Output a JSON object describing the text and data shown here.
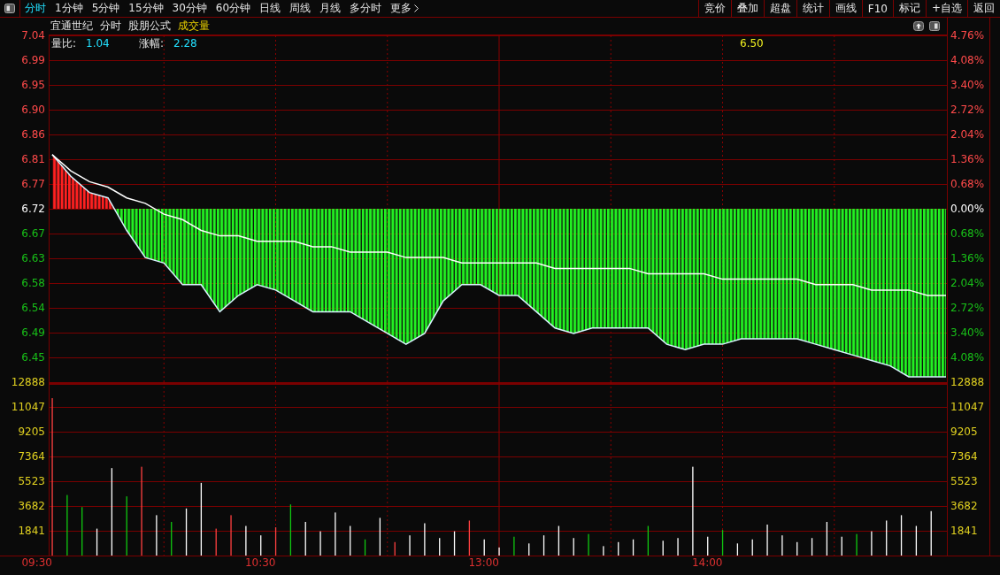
{
  "toolbar": {
    "tabs": [
      {
        "label": "分时",
        "selected": true
      },
      {
        "label": "1分钟",
        "selected": false
      },
      {
        "label": "5分钟",
        "selected": false
      },
      {
        "label": "15分钟",
        "selected": false
      },
      {
        "label": "30分钟",
        "selected": false
      },
      {
        "label": "60分钟",
        "selected": false
      },
      {
        "label": "日线",
        "selected": false
      },
      {
        "label": "周线",
        "selected": false
      },
      {
        "label": "月线",
        "selected": false
      },
      {
        "label": "多分时",
        "selected": false
      }
    ],
    "more": "更多",
    "buttons": [
      "竞价",
      "叠加",
      "超盘",
      "统计",
      "画线",
      "F10",
      "标记",
      "+自选",
      "返回"
    ]
  },
  "header": {
    "stock": "宜通世纪",
    "view": "分时",
    "formula": "股朋公式",
    "indicator": "成交量"
  },
  "info": [
    {
      "label": "量比:",
      "value": "1.04"
    },
    {
      "label": "涨幅:",
      "value": "2.28"
    }
  ],
  "cursor_price": "6.50",
  "price_chart": {
    "right_axis": [
      {
        "label": "4.76%",
        "kind": "up"
      },
      {
        "label": "4.08%",
        "kind": "up"
      },
      {
        "label": "3.40%",
        "kind": "up"
      },
      {
        "label": "2.72%",
        "kind": "up"
      },
      {
        "label": "2.04%",
        "kind": "up"
      },
      {
        "label": "1.36%",
        "kind": "up"
      },
      {
        "label": "0.68%",
        "kind": "up"
      },
      {
        "label": "0.00%",
        "kind": "flat"
      },
      {
        "label": "0.68%",
        "kind": "down"
      },
      {
        "label": "1.36%",
        "kind": "down"
      },
      {
        "label": "2.04%",
        "kind": "down"
      },
      {
        "label": "2.72%",
        "kind": "down"
      },
      {
        "label": "3.40%",
        "kind": "down"
      },
      {
        "label": "4.08%",
        "kind": "down"
      }
    ],
    "chart_data": {
      "type": "line",
      "categories": [
        null,
        null,
        null,
        null,
        null,
        null,
        null,
        null,
        null,
        null,
        null,
        null,
        null,
        null,
        null,
        null,
        null,
        null,
        null,
        null,
        null,
        null,
        null,
        null,
        null,
        null,
        null,
        null,
        null,
        null,
        null,
        null,
        null,
        null,
        null,
        null,
        null,
        null,
        null,
        null,
        null,
        null,
        null,
        null,
        null,
        null,
        null,
        null,
        null
      ],
      "series": [
        {
          "color": "#d8f4ff",
          "values": [
            6.82,
            6.78,
            6.75,
            6.74,
            6.68,
            6.63,
            6.62,
            6.58,
            6.58,
            6.53,
            6.56,
            6.58,
            6.57,
            6.55,
            6.53,
            6.53,
            6.53,
            6.51,
            6.49,
            6.47,
            6.49,
            6.55,
            6.58,
            6.58,
            6.56,
            6.56,
            6.53,
            6.5,
            6.49,
            6.5,
            6.5,
            6.5,
            6.5,
            6.47,
            6.46,
            6.47,
            6.47,
            6.48,
            6.48,
            6.48,
            6.48,
            6.47,
            6.46,
            6.45,
            6.44,
            6.43,
            6.41,
            6.41,
            6.41
          ]
        },
        {
          "color": "#ffffff",
          "values": [
            6.82,
            6.79,
            6.77,
            6.76,
            6.74,
            6.73,
            6.71,
            6.7,
            6.68,
            6.67,
            6.67,
            6.66,
            6.66,
            6.66,
            6.65,
            6.65,
            6.64,
            6.64,
            6.64,
            6.63,
            6.63,
            6.63,
            6.62,
            6.62,
            6.62,
            6.62,
            6.62,
            6.61,
            6.61,
            6.61,
            6.61,
            6.61,
            6.6,
            6.6,
            6.6,
            6.6,
            6.59,
            6.59,
            6.59,
            6.59,
            6.59,
            6.58,
            6.58,
            6.58,
            6.57,
            6.57,
            6.57,
            6.56,
            6.56
          ]
        }
      ],
      "ylim": [
        6.4,
        7.04
      ],
      "grid": true,
      "yticks": [
        {
          "value": 7.04,
          "label": "7.04"
        },
        {
          "value": 6.9943,
          "label": "6.99"
        },
        {
          "value": 6.9486,
          "label": "6.95"
        },
        {
          "value": 6.9029,
          "label": "6.90"
        },
        {
          "value": 6.8571,
          "label": "6.86"
        },
        {
          "value": 6.8114,
          "label": "6.81"
        },
        {
          "value": 6.7657,
          "label": "6.77"
        },
        {
          "value": 6.72,
          "label": "6.72"
        },
        {
          "value": 6.6743,
          "label": "6.67"
        },
        {
          "value": 6.6286,
          "label": "6.63"
        },
        {
          "value": 6.5829,
          "label": "6.58"
        },
        {
          "value": 6.5371,
          "label": "6.54"
        },
        {
          "value": 6.4914,
          "label": "6.49"
        },
        {
          "value": 6.4457,
          "label": "6.45"
        }
      ]
    }
  },
  "volume_chart": {
    "right_axis": [
      "12888",
      "11047",
      "9205",
      "7364",
      "5523",
      "3682",
      "1841"
    ],
    "chart_data": {
      "type": "bar",
      "categories": [
        null,
        null,
        null,
        null,
        null,
        null,
        null,
        null,
        null,
        null,
        null,
        null,
        null,
        null,
        null,
        null,
        null,
        null,
        null,
        null,
        null,
        null,
        null,
        null,
        null,
        null,
        null,
        null,
        null,
        null,
        null,
        null,
        null,
        null,
        null,
        null,
        null,
        null,
        null,
        null,
        null,
        null,
        null,
        null,
        null,
        null,
        null,
        null,
        null,
        null,
        null,
        null,
        null,
        null,
        null,
        null,
        null,
        null,
        null,
        null
      ],
      "series": [
        {
          "color": "#ff4040",
          "values": [
            11700,
            null,
            null,
            null,
            null,
            null,
            6600,
            null,
            null,
            null,
            null,
            2000,
            3000,
            null,
            null,
            2100,
            null,
            null,
            null,
            null,
            null,
            null,
            null,
            1000,
            null,
            null,
            null,
            null,
            2600,
            null,
            null,
            null,
            null,
            null,
            null,
            null,
            null,
            null,
            null,
            null,
            null,
            null,
            null,
            null,
            null,
            null,
            null,
            null,
            null,
            null,
            null,
            null,
            null,
            null,
            null,
            null,
            null,
            null,
            null,
            null
          ]
        },
        {
          "color": "#10c810",
          "values": [
            null,
            4500,
            3600,
            null,
            null,
            4400,
            null,
            null,
            2500,
            null,
            null,
            null,
            null,
            null,
            null,
            null,
            3800,
            null,
            null,
            null,
            null,
            1200,
            null,
            null,
            null,
            null,
            null,
            null,
            null,
            null,
            null,
            1400,
            null,
            null,
            null,
            null,
            1600,
            null,
            null,
            null,
            2200,
            null,
            null,
            null,
            null,
            1900,
            null,
            null,
            null,
            null,
            null,
            null,
            null,
            null,
            1600,
            null,
            null,
            null,
            null,
            null
          ]
        },
        {
          "color": "#ffffff",
          "values": [
            null,
            null,
            null,
            2000,
            6500,
            null,
            null,
            3000,
            null,
            3500,
            5400,
            null,
            null,
            2200,
            1500,
            null,
            null,
            2500,
            1800,
            3200,
            2200,
            null,
            2800,
            null,
            1500,
            2400,
            1300,
            1800,
            null,
            1200,
            600,
            null,
            900,
            1500,
            2200,
            1300,
            null,
            700,
            1000,
            1200,
            null,
            1100,
            1300,
            6600,
            1400,
            null,
            900,
            1200,
            2300,
            1500,
            1000,
            1300,
            2500,
            1400,
            null,
            1800,
            2600,
            3000,
            2200,
            3300
          ]
        }
      ],
      "stacked": true,
      "ylim": [
        0,
        12888
      ],
      "grid": true,
      "yticks": [
        {
          "value": 12888,
          "label": "12888"
        },
        {
          "value": 11046.9,
          "label": "11047"
        },
        {
          "value": 9205.4,
          "label": "9205"
        },
        {
          "value": 7364.4,
          "label": "7364"
        },
        {
          "value": 5523.4,
          "label": "5523"
        },
        {
          "value": 3682.3,
          "label": "3682"
        },
        {
          "value": 1841.1,
          "label": "1841"
        }
      ]
    }
  },
  "time_axis": [
    "09:30",
    "10:30",
    "13:00",
    "14:00"
  ]
}
